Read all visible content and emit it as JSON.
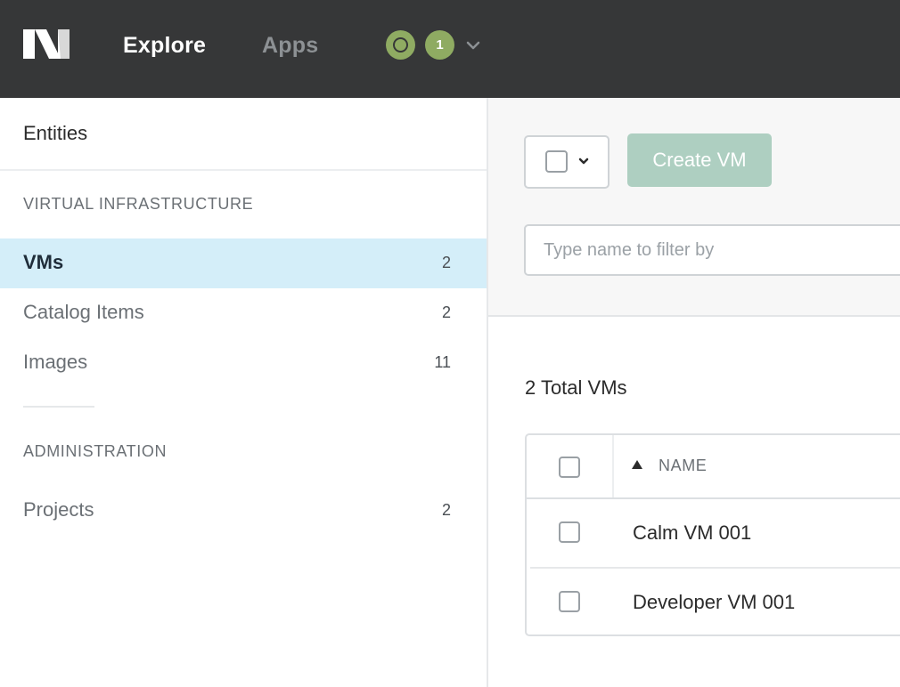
{
  "header": {
    "logo_icon": "nutanix-logo-icon",
    "nav": {
      "explore_label": "Explore",
      "apps_label": "Apps"
    },
    "status_icon": "status-ring-icon",
    "notification_count": "1",
    "user_menu_icon": "chevron-down-icon",
    "colors": {
      "bar": "#363738",
      "accent_green": "#8fab62"
    }
  },
  "sidebar": {
    "title": "Entities",
    "sections": {
      "virtual_infrastructure": "VIRTUAL INFRASTRUCTURE",
      "administration": "ADMINISTRATION"
    },
    "items": [
      {
        "label": "VMs",
        "count": "2",
        "active": true
      },
      {
        "label": "Catalog Items",
        "count": "2",
        "active": false
      },
      {
        "label": "Images",
        "count": "11",
        "active": false
      },
      {
        "label": "Projects",
        "count": "2",
        "active": false
      }
    ],
    "active_color": "#d4eef9"
  },
  "toolbar": {
    "bulk_select_icon": "chevron-down-icon",
    "create_label": "Create VM",
    "create_color": "#aecfc1",
    "filter_placeholder": "Type name to filter by"
  },
  "main": {
    "total_label": "2 Total VMs",
    "table": {
      "columns": [
        {
          "label": "NAME",
          "sort": "ascending"
        }
      ],
      "rows": [
        {
          "name": "Calm VM 001"
        },
        {
          "name": "Developer VM 001"
        }
      ]
    }
  }
}
